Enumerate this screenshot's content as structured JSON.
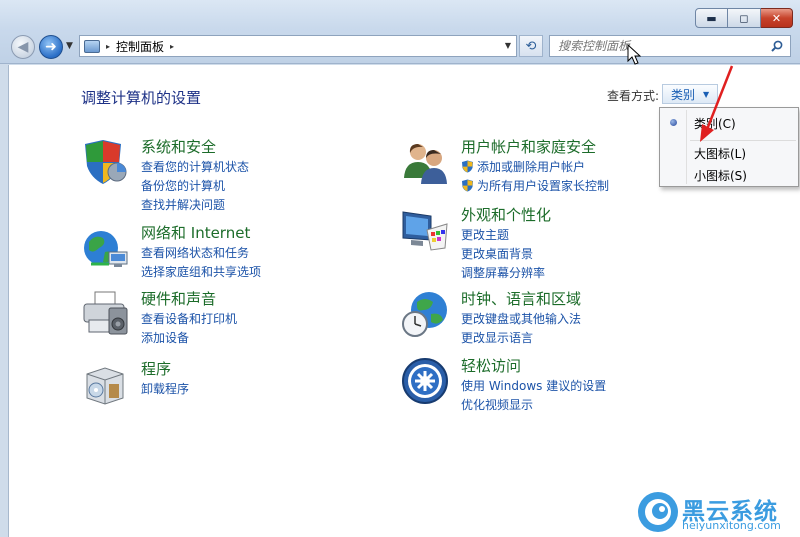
{
  "window": {
    "controls": {
      "minimize": "▬",
      "maximize": "◻",
      "close": "✕"
    }
  },
  "nav": {
    "back": "◀",
    "forward": "➜",
    "address_separator": "▸",
    "address_path": "控制面板",
    "address_trail": "▸",
    "refresh": "⟲",
    "search_placeholder": "搜索控制面板"
  },
  "main": {
    "page_title": "调整计算机的设置",
    "view_by_label": "查看方式:",
    "view_by_value": "类别",
    "categories": [
      {
        "title": "系统和安全",
        "links": [
          "查看您的计算机状态",
          "备份您的计算机",
          "查找并解决问题"
        ]
      },
      {
        "title": "网络和 Internet",
        "links": [
          "查看网络状态和任务",
          "选择家庭组和共享选项"
        ]
      },
      {
        "title": "硬件和声音",
        "links": [
          "查看设备和打印机",
          "添加设备"
        ]
      },
      {
        "title": "程序",
        "links": [
          "卸载程序"
        ]
      },
      {
        "title": "用户帐户和家庭安全",
        "links": [
          "添加或删除用户帐户",
          "为所有用户设置家长控制"
        ]
      },
      {
        "title": "外观和个性化",
        "links": [
          "更改主题",
          "更改桌面背景",
          "调整屏幕分辨率"
        ]
      },
      {
        "title": "时钟、语言和区域",
        "links": [
          "更改键盘或其他输入法",
          "更改显示语言"
        ]
      },
      {
        "title": "轻松访问",
        "links": [
          "使用 Windows 建议的设置",
          "优化视频显示"
        ]
      }
    ]
  },
  "view_menu": {
    "items": [
      "类别(C)",
      "大图标(L)",
      "小图标(S)"
    ],
    "selected_index": 0
  },
  "watermark": {
    "title": "黑云系统",
    "subtitle": "heiyunxitong.com"
  },
  "colors": {
    "category_title": "#1c6c2a",
    "link": "#1c53a8",
    "page_title": "#1e3287",
    "annotation_arrow": "#e02020"
  }
}
